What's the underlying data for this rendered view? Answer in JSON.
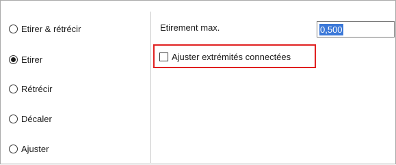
{
  "mode_options": [
    {
      "label": "Etirer & rétrécir",
      "selected": false
    },
    {
      "label": "Etirer",
      "selected": true
    },
    {
      "label": "Rétrécir",
      "selected": false
    },
    {
      "label": "Décaler",
      "selected": false
    },
    {
      "label": "Ajuster",
      "selected": false
    }
  ],
  "settings": {
    "max_stretch_label": "Etirement max.",
    "max_stretch_value": "0,500",
    "adjust_connected_ends_label": "Ajuster extrémités connectées",
    "adjust_connected_ends_checked": false
  },
  "colors": {
    "highlight_border": "#e02020",
    "selection_background": "#3b78d8"
  }
}
